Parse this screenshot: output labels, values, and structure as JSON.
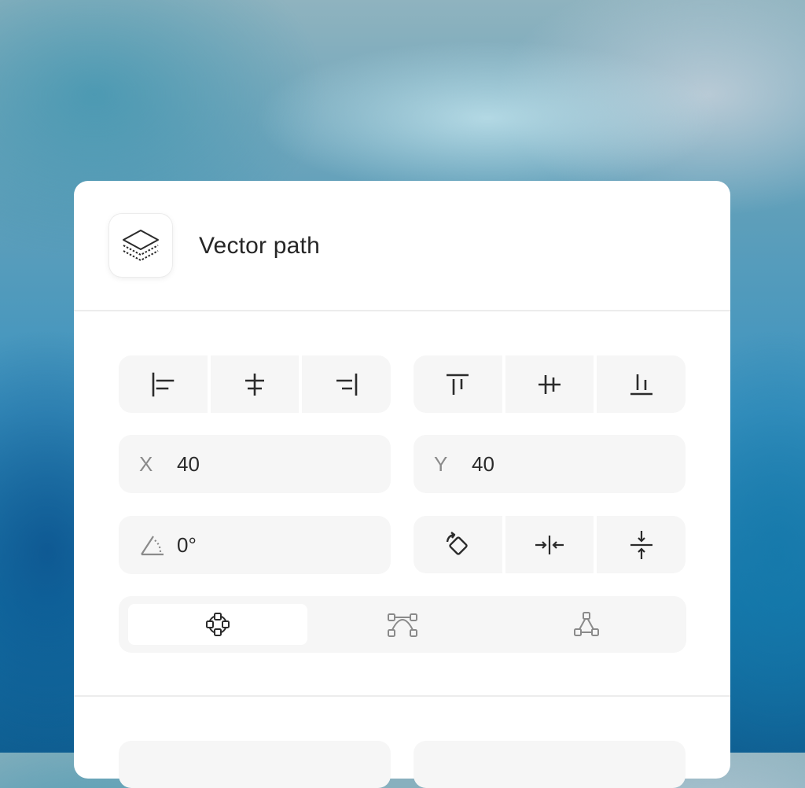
{
  "panel": {
    "title": "Vector path",
    "icon": "layers-icon"
  },
  "align_horizontal": [
    {
      "icon": "align-left-icon"
    },
    {
      "icon": "align-center-horizontal-icon"
    },
    {
      "icon": "align-right-icon"
    }
  ],
  "align_vertical": [
    {
      "icon": "align-top-icon"
    },
    {
      "icon": "align-middle-vertical-icon"
    },
    {
      "icon": "align-bottom-icon"
    }
  ],
  "position": {
    "x_label": "X",
    "x_value": "40",
    "y_label": "Y",
    "y_value": "40"
  },
  "rotation": {
    "icon": "angle-icon",
    "value": "0°"
  },
  "transform_actions": [
    {
      "icon": "rotate-icon"
    },
    {
      "icon": "flip-horizontal-icon"
    },
    {
      "icon": "flip-vertical-icon"
    }
  ],
  "path_modes": {
    "selected": 0,
    "items": [
      {
        "icon": "node-circle-icon"
      },
      {
        "icon": "bezier-curve-icon"
      },
      {
        "icon": "triangle-nodes-icon"
      }
    ]
  },
  "colors": {
    "panel_bg": "#ffffff",
    "field_bg": "#f6f6f6",
    "text": "#262626",
    "muted_text": "#8a8a8a"
  }
}
